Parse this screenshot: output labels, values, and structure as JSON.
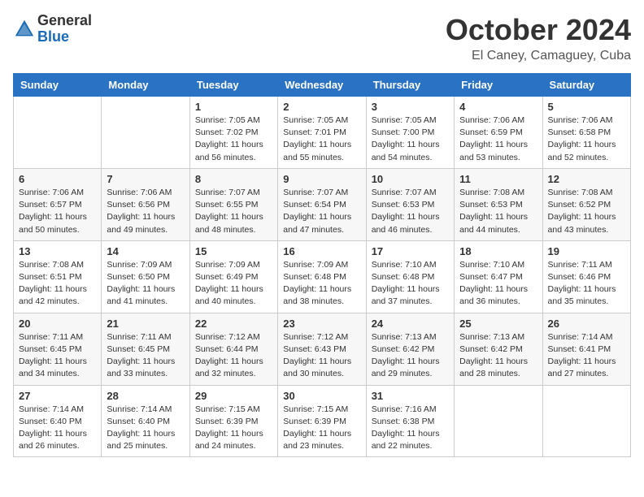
{
  "header": {
    "logo_general": "General",
    "logo_blue": "Blue",
    "month_title": "October 2024",
    "location": "El Caney, Camaguey, Cuba"
  },
  "days_of_week": [
    "Sunday",
    "Monday",
    "Tuesday",
    "Wednesday",
    "Thursday",
    "Friday",
    "Saturday"
  ],
  "weeks": [
    [
      {
        "day": "",
        "sunrise": "",
        "sunset": "",
        "daylight": ""
      },
      {
        "day": "",
        "sunrise": "",
        "sunset": "",
        "daylight": ""
      },
      {
        "day": "1",
        "sunrise": "Sunrise: 7:05 AM",
        "sunset": "Sunset: 7:02 PM",
        "daylight": "Daylight: 11 hours and 56 minutes."
      },
      {
        "day": "2",
        "sunrise": "Sunrise: 7:05 AM",
        "sunset": "Sunset: 7:01 PM",
        "daylight": "Daylight: 11 hours and 55 minutes."
      },
      {
        "day": "3",
        "sunrise": "Sunrise: 7:05 AM",
        "sunset": "Sunset: 7:00 PM",
        "daylight": "Daylight: 11 hours and 54 minutes."
      },
      {
        "day": "4",
        "sunrise": "Sunrise: 7:06 AM",
        "sunset": "Sunset: 6:59 PM",
        "daylight": "Daylight: 11 hours and 53 minutes."
      },
      {
        "day": "5",
        "sunrise": "Sunrise: 7:06 AM",
        "sunset": "Sunset: 6:58 PM",
        "daylight": "Daylight: 11 hours and 52 minutes."
      }
    ],
    [
      {
        "day": "6",
        "sunrise": "Sunrise: 7:06 AM",
        "sunset": "Sunset: 6:57 PM",
        "daylight": "Daylight: 11 hours and 50 minutes."
      },
      {
        "day": "7",
        "sunrise": "Sunrise: 7:06 AM",
        "sunset": "Sunset: 6:56 PM",
        "daylight": "Daylight: 11 hours and 49 minutes."
      },
      {
        "day": "8",
        "sunrise": "Sunrise: 7:07 AM",
        "sunset": "Sunset: 6:55 PM",
        "daylight": "Daylight: 11 hours and 48 minutes."
      },
      {
        "day": "9",
        "sunrise": "Sunrise: 7:07 AM",
        "sunset": "Sunset: 6:54 PM",
        "daylight": "Daylight: 11 hours and 47 minutes."
      },
      {
        "day": "10",
        "sunrise": "Sunrise: 7:07 AM",
        "sunset": "Sunset: 6:53 PM",
        "daylight": "Daylight: 11 hours and 46 minutes."
      },
      {
        "day": "11",
        "sunrise": "Sunrise: 7:08 AM",
        "sunset": "Sunset: 6:53 PM",
        "daylight": "Daylight: 11 hours and 44 minutes."
      },
      {
        "day": "12",
        "sunrise": "Sunrise: 7:08 AM",
        "sunset": "Sunset: 6:52 PM",
        "daylight": "Daylight: 11 hours and 43 minutes."
      }
    ],
    [
      {
        "day": "13",
        "sunrise": "Sunrise: 7:08 AM",
        "sunset": "Sunset: 6:51 PM",
        "daylight": "Daylight: 11 hours and 42 minutes."
      },
      {
        "day": "14",
        "sunrise": "Sunrise: 7:09 AM",
        "sunset": "Sunset: 6:50 PM",
        "daylight": "Daylight: 11 hours and 41 minutes."
      },
      {
        "day": "15",
        "sunrise": "Sunrise: 7:09 AM",
        "sunset": "Sunset: 6:49 PM",
        "daylight": "Daylight: 11 hours and 40 minutes."
      },
      {
        "day": "16",
        "sunrise": "Sunrise: 7:09 AM",
        "sunset": "Sunset: 6:48 PM",
        "daylight": "Daylight: 11 hours and 38 minutes."
      },
      {
        "day": "17",
        "sunrise": "Sunrise: 7:10 AM",
        "sunset": "Sunset: 6:48 PM",
        "daylight": "Daylight: 11 hours and 37 minutes."
      },
      {
        "day": "18",
        "sunrise": "Sunrise: 7:10 AM",
        "sunset": "Sunset: 6:47 PM",
        "daylight": "Daylight: 11 hours and 36 minutes."
      },
      {
        "day": "19",
        "sunrise": "Sunrise: 7:11 AM",
        "sunset": "Sunset: 6:46 PM",
        "daylight": "Daylight: 11 hours and 35 minutes."
      }
    ],
    [
      {
        "day": "20",
        "sunrise": "Sunrise: 7:11 AM",
        "sunset": "Sunset: 6:45 PM",
        "daylight": "Daylight: 11 hours and 34 minutes."
      },
      {
        "day": "21",
        "sunrise": "Sunrise: 7:11 AM",
        "sunset": "Sunset: 6:45 PM",
        "daylight": "Daylight: 11 hours and 33 minutes."
      },
      {
        "day": "22",
        "sunrise": "Sunrise: 7:12 AM",
        "sunset": "Sunset: 6:44 PM",
        "daylight": "Daylight: 11 hours and 32 minutes."
      },
      {
        "day": "23",
        "sunrise": "Sunrise: 7:12 AM",
        "sunset": "Sunset: 6:43 PM",
        "daylight": "Daylight: 11 hours and 30 minutes."
      },
      {
        "day": "24",
        "sunrise": "Sunrise: 7:13 AM",
        "sunset": "Sunset: 6:42 PM",
        "daylight": "Daylight: 11 hours and 29 minutes."
      },
      {
        "day": "25",
        "sunrise": "Sunrise: 7:13 AM",
        "sunset": "Sunset: 6:42 PM",
        "daylight": "Daylight: 11 hours and 28 minutes."
      },
      {
        "day": "26",
        "sunrise": "Sunrise: 7:14 AM",
        "sunset": "Sunset: 6:41 PM",
        "daylight": "Daylight: 11 hours and 27 minutes."
      }
    ],
    [
      {
        "day": "27",
        "sunrise": "Sunrise: 7:14 AM",
        "sunset": "Sunset: 6:40 PM",
        "daylight": "Daylight: 11 hours and 26 minutes."
      },
      {
        "day": "28",
        "sunrise": "Sunrise: 7:14 AM",
        "sunset": "Sunset: 6:40 PM",
        "daylight": "Daylight: 11 hours and 25 minutes."
      },
      {
        "day": "29",
        "sunrise": "Sunrise: 7:15 AM",
        "sunset": "Sunset: 6:39 PM",
        "daylight": "Daylight: 11 hours and 24 minutes."
      },
      {
        "day": "30",
        "sunrise": "Sunrise: 7:15 AM",
        "sunset": "Sunset: 6:39 PM",
        "daylight": "Daylight: 11 hours and 23 minutes."
      },
      {
        "day": "31",
        "sunrise": "Sunrise: 7:16 AM",
        "sunset": "Sunset: 6:38 PM",
        "daylight": "Daylight: 11 hours and 22 minutes."
      },
      {
        "day": "",
        "sunrise": "",
        "sunset": "",
        "daylight": ""
      },
      {
        "day": "",
        "sunrise": "",
        "sunset": "",
        "daylight": ""
      }
    ]
  ]
}
